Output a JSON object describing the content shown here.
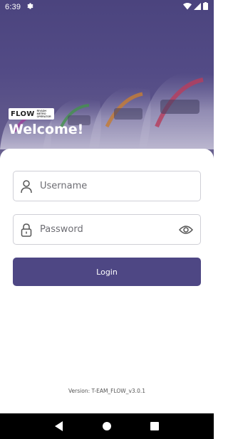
{
  "status_bar": {
    "time": "6:39",
    "icons": [
      "settings-icon",
      "wifi-icon",
      "cellular-signal-icon",
      "battery-icon"
    ]
  },
  "header": {
    "brand_logo_text": "FLOW",
    "brand_logo_subtext": "RIYADH METRO OPERATOR",
    "welcome_text": "Welcome!"
  },
  "form": {
    "username": {
      "placeholder": "Username",
      "value": "",
      "icon": "person-icon"
    },
    "password": {
      "placeholder": "Password",
      "value": "",
      "icon": "lock-icon",
      "toggle_icon": "eye-icon"
    },
    "login_label": "Login"
  },
  "footer": {
    "version_text": "Version: T-EAM_FLOW_v3.0.1"
  },
  "nav_bar": {
    "buttons": [
      "back-icon",
      "home-icon",
      "recents-icon"
    ]
  },
  "colors": {
    "primary": "#4e4784",
    "hero_top": "#4b447e",
    "field_border": "#cfcfd6",
    "nav_bar": "#000000"
  }
}
